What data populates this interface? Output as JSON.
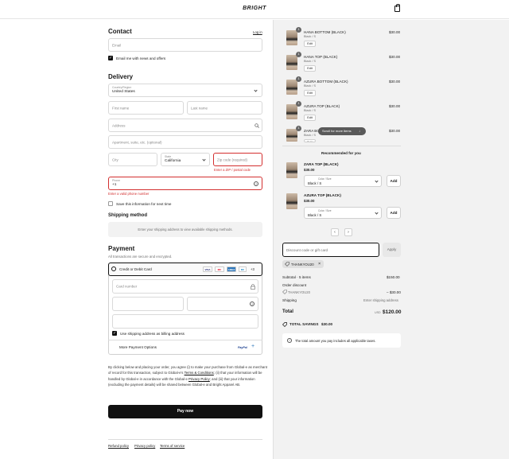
{
  "brand": {
    "logo": "BRIGHT"
  },
  "contact": {
    "title": "Contact",
    "login_label": "Log in",
    "email_placeholder": "Email",
    "email_news_label": "Email me with news and offers"
  },
  "delivery": {
    "title": "Delivery",
    "country_label": "Country/Region",
    "country_value": "United States",
    "first_name_placeholder": "First name",
    "last_name_placeholder": "Last name",
    "address_placeholder": "Address",
    "apartment_placeholder": "Apartment, suite, etc. (optional)",
    "city_placeholder": "City",
    "state_label": "State",
    "state_value": "California",
    "zip_placeholder": "Zip code (required)",
    "zip_error": "Enter a ZIP / postal code",
    "phone_label": "Phone",
    "phone_value": "+1",
    "phone_error": "Enter a valid phone number",
    "save_info_label": "Save this information for next time"
  },
  "shipping": {
    "title": "Shipping method",
    "placeholder_text": "Enter your shipping address to view available shipping methods."
  },
  "payment": {
    "title": "Payment",
    "subtitle": "All transactions are secure and encrypted.",
    "card_option_label": "Credit or Debit Card",
    "card_brands": [
      "VISA",
      "MC",
      "AMEX",
      "DC"
    ],
    "more_brands": "+3",
    "card_number_placeholder": "Card number",
    "billing_same_label": "Use shipping address as billing address",
    "more_options_label": "More Payment Options",
    "more_options_brand": "PayPal",
    "more_options_plus": "+"
  },
  "legal": {
    "text_1": "By clicking below and placing your order, you agree (i) to make your purchase from Global-e as merchant of record for this transaction, subject to Global-e's ",
    "terms_link": "Terms & Conditions",
    "text_2": "; (ii) that your information will be handled by Global-e in accordance with the Global-e ",
    "privacy_link": "Privacy Policy",
    "text_3": "; and (iii) that your information (excluding the payment details) will be shared between Global-e and Bright Apparel AB."
  },
  "pay_now_label": "Pay now",
  "footer_links": [
    "Refund policy",
    "Privacy policy",
    "Terms of service"
  ],
  "cart": {
    "items": [
      {
        "name": "HANA BOTTOM (BLACK)",
        "variant": "Black / S",
        "price": "$30.00",
        "qty": "1",
        "edit": "Edit"
      },
      {
        "name": "HANA TOP (BLACK)",
        "variant": "Black / S",
        "price": "$30.00",
        "qty": "1",
        "edit": "Edit"
      },
      {
        "name": "AZURA BOTTOM (BLACK)",
        "variant": "Black / S",
        "price": "$30.00",
        "qty": "1",
        "edit": "Edit"
      },
      {
        "name": "AZURA TOP (BLACK)",
        "variant": "Black / S",
        "price": "$30.00",
        "qty": "1",
        "edit": "Edit"
      },
      {
        "name": "ZARA BO",
        "variant": "Black / S",
        "price": "$30.00",
        "qty": "1",
        "edit": "Edit"
      }
    ],
    "scroll_pill": "Scroll for more items",
    "scroll_arrow": "↓"
  },
  "recommended": {
    "title": "Recommended for you",
    "items": [
      {
        "name": "ZARA TOP (BLACK)",
        "price": "$30.00",
        "select_label": "Color / Size",
        "select_value": "Black / S",
        "add": "Add"
      },
      {
        "name": "AZURA TOP (BLACK)",
        "price": "$30.00",
        "select_label": "Color / Size",
        "select_value": "Black / S",
        "add": "Add"
      }
    ],
    "prev": "‹",
    "next": "›"
  },
  "discount": {
    "placeholder": "Discount code or gift card",
    "apply_label": "Apply",
    "applied_code": "THANKYOU20",
    "remove": "×"
  },
  "summary": {
    "subtotal_label": "Subtotal · 5 items",
    "subtotal_value": "$150.00",
    "order_discount_label": "Order discount",
    "discount_code": "THANKYOU20",
    "discount_value": "– $30.00",
    "shipping_label": "Shipping",
    "shipping_value": "Enter shipping address",
    "total_label": "Total",
    "currency": "USD",
    "total_value": "$120.00",
    "savings_label": "TOTAL SAVINGS",
    "savings_value": "$30.00",
    "info_text": "The total amount you pay includes all applicable taxes.",
    "info_icon": "i"
  }
}
